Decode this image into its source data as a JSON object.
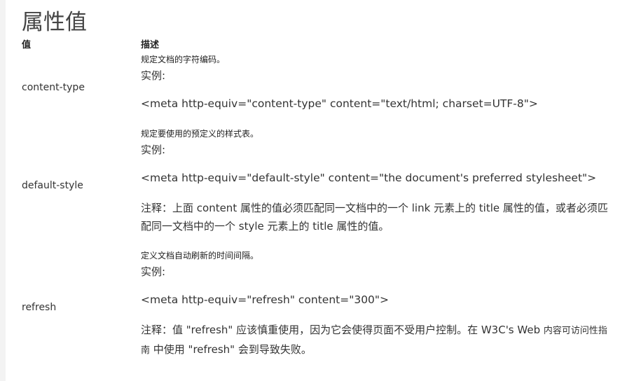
{
  "page": {
    "title": "属性值"
  },
  "table": {
    "col_value": "值",
    "col_desc": "描述",
    "rows": [
      {
        "value": "content-type",
        "desc": "规定文档的字符编码。",
        "example_label": "实例:",
        "code": "<meta http-equiv=\"content-type\" content=\"text/html; charset=UTF-8\">"
      },
      {
        "value": "default-style",
        "desc": "规定要使用的预定义的样式表。",
        "example_label": "实例:",
        "code": "<meta http-equiv=\"default-style\" content=\"the document's preferred stylesheet\">",
        "note": "注释：上面 content 属性的值必须匹配同一文档中的一个 link 元素上的 title 属性的值，或者必须匹配同一文档中的一个 style 元素上的 title 属性的值。"
      },
      {
        "value": "refresh",
        "desc": "定义文档自动刷新的时间间隔。",
        "example_label": "实例:",
        "code": "<meta http-equiv=\"refresh\" content=\"300\">",
        "note_part1": "注释：值 \"refresh\" 应该慎重使用，因为它会使得页面不受用户控制。在 W3C's Web ",
        "note_link": "内容可访问性指南",
        "note_part2": " 中使用 \"refresh\" 会到导致失败。"
      }
    ]
  }
}
